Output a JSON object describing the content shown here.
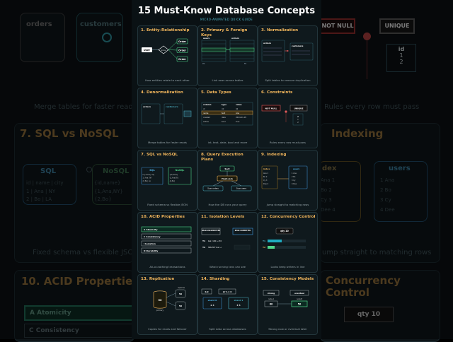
{
  "page": {
    "title": "15 Must-Know Database Concepts",
    "subtitle": "MICRO-ANIMATED QUICK GUIDE"
  },
  "background": {
    "orders_label": "orders",
    "customers_label": "customers",
    "not_null_label": "NOT NULL",
    "unique_label": "UNIQUE",
    "id_label": "id",
    "id_values": [
      "1",
      "2"
    ],
    "caption_left": "Merge tables for faster reads",
    "caption_right": "Rules every row must pass",
    "sql_title": "7. SQL vs NoSQL",
    "indexing_title": "Indexing",
    "sql_label": "SQL",
    "nosql_label": "NoSQL",
    "sql_fields": "id | name | city",
    "sql_rows": [
      "1 | Ana | NY",
      "2 | Bo | LA"
    ],
    "nosql_rows": [
      "{id,name}",
      "{1,Ana,NY}",
      "{2,Bo}"
    ],
    "index_label": "dex",
    "users_label": "users",
    "index_rows": [
      "Ana 1",
      "Bo 2",
      "Cy 3",
      "Dee 4"
    ],
    "users_rows": [
      "1 Ana",
      "2 Bo",
      "3 Cy",
      "4 Dee"
    ],
    "caption_left2": "Fixed schema vs flexible JSON",
    "caption_right2": "Jump straight to matching rows",
    "acid_title": "10. ACID Properties",
    "acid_rows": [
      "A  Atomicity",
      "C  Consistency"
    ],
    "concurrency_title": "Concurrency Control",
    "qty_label": "qty 10"
  },
  "cards": [
    {
      "title": "1. Entity-Relationship",
      "caption": "How entities relate to each other",
      "labels": {
        "left": "User",
        "mid": "places",
        "r1": "Order",
        "r2": "Order",
        "r3": "Order"
      }
    },
    {
      "title": "2. Primary & Foreign Keys",
      "caption": "Link rows across tables",
      "labels": {
        "t1": "users",
        "t2": "orders",
        "pk": "PK",
        "fk": "FK"
      }
    },
    {
      "title": "3. Normalization",
      "caption": "Split tables to remove duplication",
      "labels": {
        "t1": "orders",
        "t2": "customers"
      }
    },
    {
      "title": "4. Denormalization",
      "caption": "Merge tables for faster reads",
      "labels": {
        "t1": "orders",
        "t2": "customers"
      }
    },
    {
      "title": "5. Data Types",
      "caption": "int, text, date, bool and more",
      "labels": {
        "h1": "column",
        "h2": "type",
        "h3": "value",
        "rows": [
          [
            "id",
            "int",
            "42"
          ],
          [
            "name",
            "text",
            "Ana"
          ],
          [
            "created",
            "date",
            "2024-01-05"
          ],
          [
            "active",
            "bool",
            "true"
          ]
        ]
      }
    },
    {
      "title": "6. Constraints",
      "caption": "Rules every row must pass",
      "labels": {
        "a": "NOT NULL",
        "b": "UNIQUE",
        "c": "id",
        "vals": [
          "1",
          "2"
        ]
      }
    },
    {
      "title": "7. SQL vs NoSQL",
      "caption": "Fixed schema vs flexible JSON",
      "labels": {
        "a": "SQL",
        "b": "NoSQL",
        "a1": "id | name | city",
        "a2": "1 | Ana | NY",
        "a3": "2 | Bo | LA",
        "b1": "{id,name}",
        "b2": "{1,Ana,NY}",
        "b3": "{2,Bo}"
      }
    },
    {
      "title": "8. Query Execution Plans",
      "caption": "How the DB runs your query",
      "labels": {
        "top": "Sort",
        "mid": "Hash join",
        "l": "Scan orders",
        "r": "Scan users"
      }
    },
    {
      "title": "9. Indexing",
      "caption": "Jump straight to matching rows",
      "labels": {
        "a": "index",
        "b": "users",
        "arows": [
          "Ana 1",
          "Bo 2",
          "Cy 3",
          "Dee 4"
        ],
        "brows": [
          "1 Ana",
          "2 Bo",
          "3 Cy",
          "4 Dee"
        ]
      }
    },
    {
      "title": "10. ACID Properties",
      "caption": "All-or-nothing transactions",
      "labels": {
        "rows": [
          "A  Atomicity",
          "C  Consistency",
          "I  Isolation",
          "D  Durability"
        ]
      }
    },
    {
      "title": "11. Isolation Levels",
      "caption": "What running txns can see",
      "labels": {
        "a": "READ UNCOMMITTED",
        "b": "READ COMMITTED",
        "t1": "T1",
        "t1v": "bal: 100 → 50",
        "t2": "T2",
        "t2v": "SELECT bal →"
      }
    },
    {
      "title": "12. Concurrency Control",
      "caption": "Locks keep writers in line",
      "labels": {
        "qty": "qty 10",
        "t1": "T1",
        "t2": "T2"
      }
    },
    {
      "title": "13. Replication",
      "caption": "Copies for reads and failover",
      "labels": {
        "primary": "primary",
        "replicas": "replicas",
        "v": "50"
      }
    },
    {
      "title": "14. Sharding",
      "caption": "Split data across databases",
      "labels": {
        "a": "0-9",
        "b": "id % 2 0",
        "s0": "shard 0",
        "s1": "shard 1",
        "s0v": "2 4",
        "s1v": "3 5"
      }
    },
    {
      "title": "15. Consistency Models",
      "caption": "Strong now or eventual later",
      "labels": {
        "a": "strong",
        "b": "eventual",
        "na": "node A",
        "nb": "node B",
        "va": "60",
        "vb": "50"
      }
    }
  ],
  "colors": {
    "accent": "#f2b65c",
    "cyan": "#4fb4c8",
    "green": "#4fd68a",
    "red": "#e05a5a"
  }
}
